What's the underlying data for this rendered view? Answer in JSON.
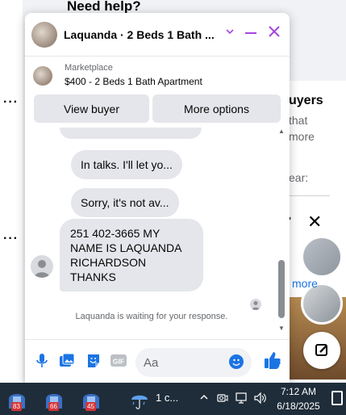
{
  "background": {
    "help_heading": "Need help?",
    "right_panel_title": "uyers",
    "right_text_1": "that",
    "right_text_2": "more",
    "right_text_3": "ear:",
    "more_link": "more"
  },
  "chat": {
    "title": "Laquanda · 2 Beds 1 Bath ...",
    "marketplace_label": "Marketplace",
    "listing_title": "$400 - 2 Beds 1 Bath Apartment",
    "view_buyer_label": "View buyer",
    "more_options_label": "More options",
    "messages": [
      "In talks. I'll let yo...",
      "Sorry, it's not av...",
      "251 402-3665 MY",
      "NAME IS LAQUANDA",
      "RICHARDSON THANKS"
    ],
    "waiting_text": "Laquanda is waiting for your response.",
    "composer_placeholder": "Aa",
    "gif_label": "GIF"
  },
  "taskbar": {
    "badges": [
      "83",
      "66",
      "45"
    ],
    "weather_text": "1 c...",
    "time": "7:12 AM",
    "date": "6/18/2025"
  },
  "colors": {
    "accent": "#a646e0",
    "messenger_blue": "#1b74e4",
    "bubble": "#e4e6eb",
    "taskbar": "#1f2d3a"
  }
}
